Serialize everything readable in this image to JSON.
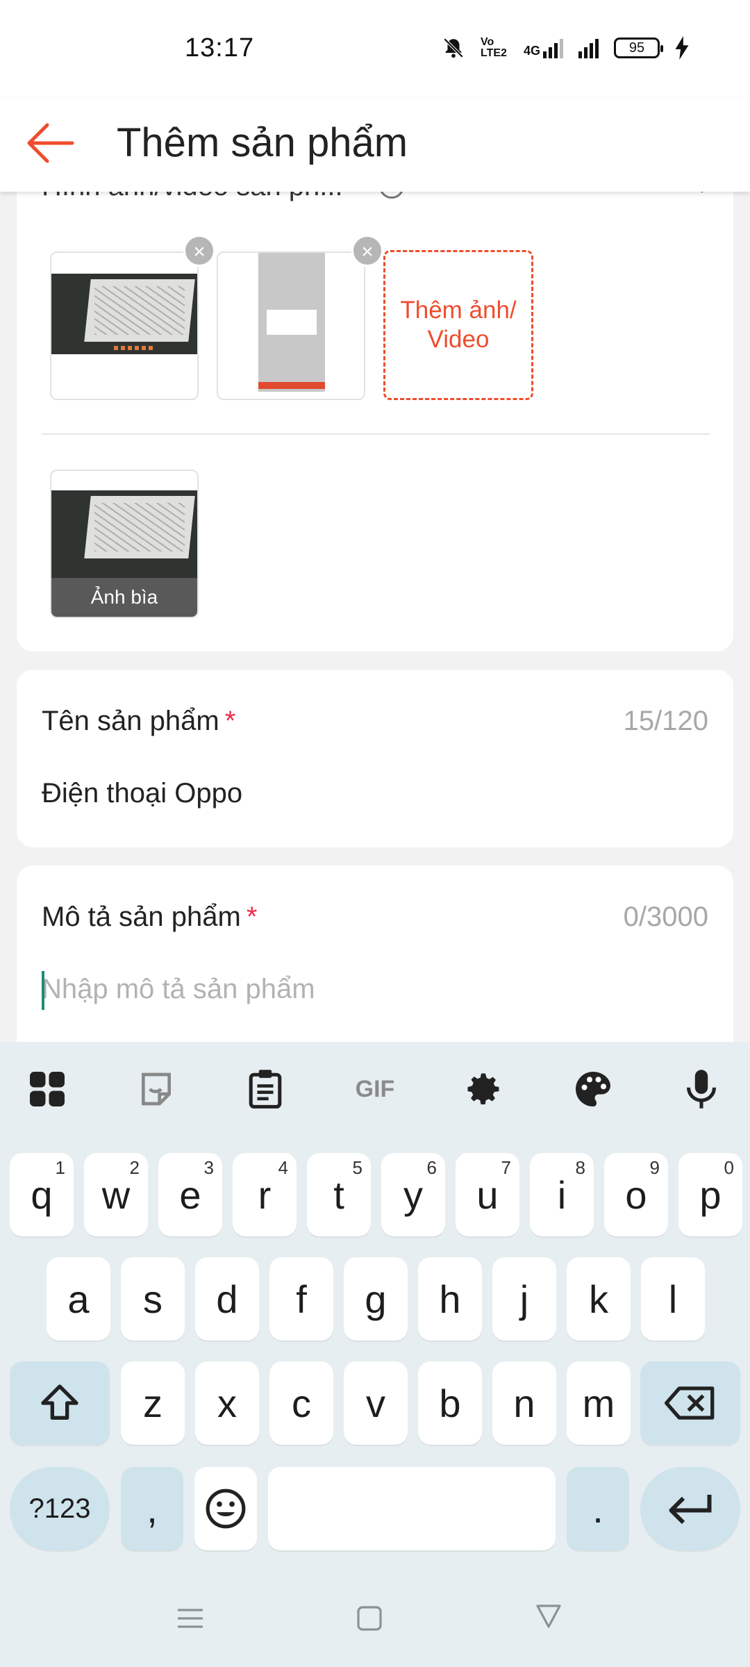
{
  "status_bar": {
    "time": "13:17",
    "network_1": "Vo LTE2",
    "network_2": "4G",
    "battery": "95"
  },
  "header": {
    "title": "Thêm sản phẩm",
    "back_icon": "arrow-left-icon",
    "accent_color": "#ee4d2d"
  },
  "media": {
    "section_title_cut": "Hình ảnh/video sản ph...",
    "add_button_label": "Thêm ảnh/ Video",
    "cover_label": "Ảnh bìa"
  },
  "product_name": {
    "label": "Tên sản phẩm",
    "required_mark": "*",
    "counter": "15/120",
    "value": "Điện thoại Oppo"
  },
  "product_description": {
    "label": "Mô tả sản phẩm",
    "required_mark": "*",
    "counter": "0/3000",
    "placeholder": "Nhập mô tả sản phẩm"
  },
  "keyboard": {
    "toolbar": [
      "apps-grid-icon",
      "sticker-icon",
      "clipboard-icon",
      "gif-icon",
      "settings-gear-icon",
      "palette-icon",
      "microphone-icon"
    ],
    "gif_label": "GIF",
    "row1": [
      {
        "k": "q",
        "h": "1"
      },
      {
        "k": "w",
        "h": "2"
      },
      {
        "k": "e",
        "h": "3"
      },
      {
        "k": "r",
        "h": "4"
      },
      {
        "k": "t",
        "h": "5"
      },
      {
        "k": "y",
        "h": "6"
      },
      {
        "k": "u",
        "h": "7"
      },
      {
        "k": "i",
        "h": "8"
      },
      {
        "k": "o",
        "h": "9"
      },
      {
        "k": "p",
        "h": "0"
      }
    ],
    "row2": [
      "a",
      "s",
      "d",
      "f",
      "g",
      "h",
      "j",
      "k",
      "l"
    ],
    "row3": [
      "z",
      "x",
      "c",
      "v",
      "b",
      "n",
      "m"
    ],
    "symbols_label": "?123",
    "comma": ",",
    "period": "."
  },
  "nav": [
    "menu-icon",
    "home-square-icon",
    "back-triangle-icon"
  ]
}
